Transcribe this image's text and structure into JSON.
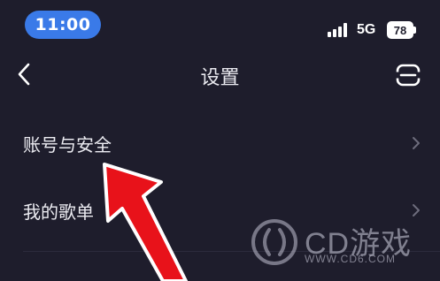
{
  "status_bar": {
    "time": "11:00",
    "network": "5G",
    "battery": "78"
  },
  "nav": {
    "title": "设置",
    "back_icon": "chevron-left-icon",
    "action_icon": "scan-icon"
  },
  "settings": {
    "items": [
      {
        "label": "账号与安全",
        "icon": "chevron-right-icon"
      },
      {
        "label": "我的歌单",
        "icon": "chevron-right-icon"
      }
    ]
  },
  "overlay": {
    "annotation_icon": "red-arrow-icon",
    "annotation_color": "#e8121a"
  },
  "watermark": {
    "brand": "CD游戏",
    "url": "WWW.CD6.COM"
  },
  "colors": {
    "background": "#1e1d2c",
    "time_pill": "#3a7ae8",
    "text": "#ececf2"
  }
}
